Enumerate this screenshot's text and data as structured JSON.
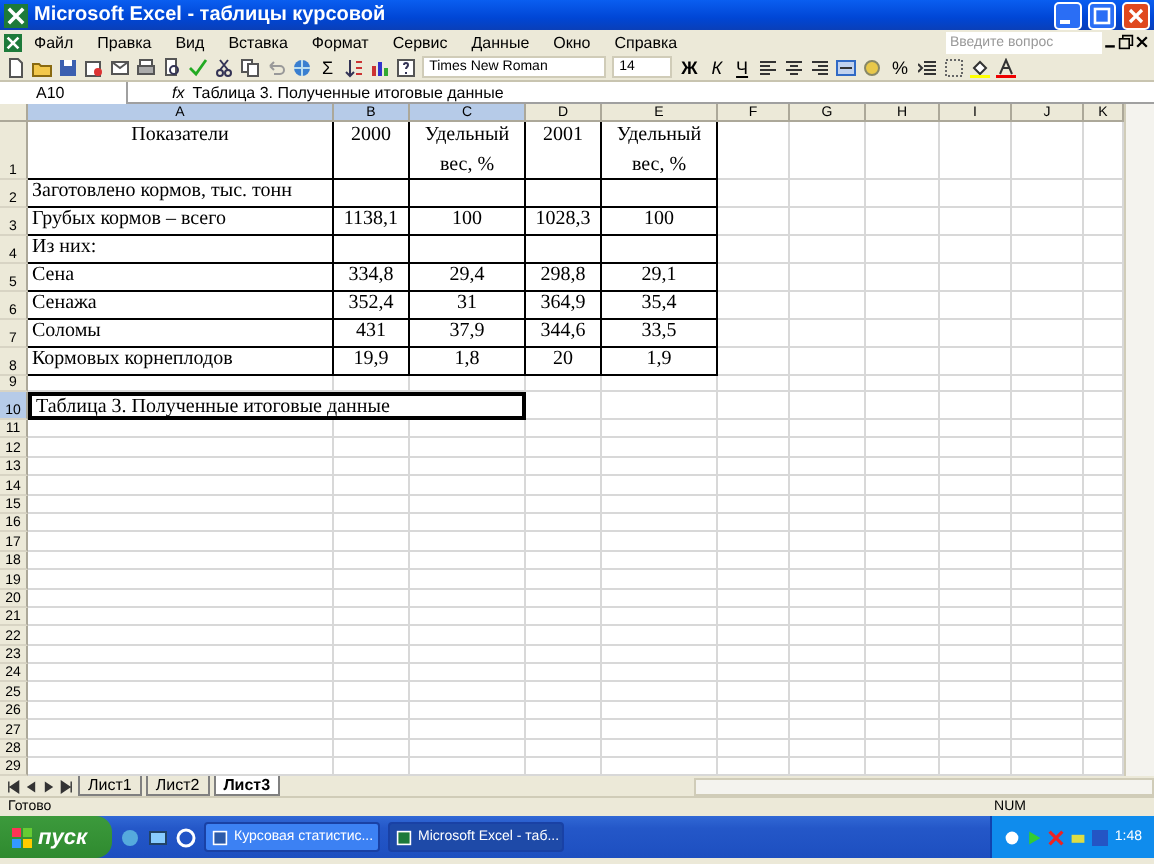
{
  "window": {
    "title": "Microsoft Excel - таблицы курсовой"
  },
  "menu": [
    "Файл",
    "Правка",
    "Вид",
    "Вставка",
    "Формат",
    "Сервис",
    "Данные",
    "Окно",
    "Справка"
  ],
  "help_field": {
    "placeholder": "Введите вопрос"
  },
  "toolbar": {
    "font": "Times New Roman",
    "size": "14",
    "bold": "Ж",
    "italic": "К",
    "underline": "Ч",
    "percent": "%",
    "sigma": "Σ"
  },
  "formula_bar": {
    "name_box": "A10",
    "fx": "fx",
    "value": "Таблица 3. Полученные итоговые данные"
  },
  "columns": [
    {
      "label": "A",
      "selected": true
    },
    {
      "label": "B",
      "selected": true
    },
    {
      "label": "C",
      "selected": true
    },
    {
      "label": "D",
      "selected": false
    },
    {
      "label": "E",
      "selected": false
    },
    {
      "label": "F",
      "selected": false
    },
    {
      "label": "G",
      "selected": false
    },
    {
      "label": "H",
      "selected": false
    },
    {
      "label": "I",
      "selected": false
    },
    {
      "label": "J",
      "selected": false
    },
    {
      "label": "K",
      "selected": false
    }
  ],
  "rows": [
    {
      "number": "1",
      "selected": false,
      "bordered": true,
      "cells": [
        "Показатели",
        "2000",
        "Удельный вес, %",
        "2001",
        "Удельный вес, %"
      ]
    },
    {
      "number": "2",
      "selected": false,
      "bordered": true,
      "cells": [
        "Заготовлено кормов, тыс. тонн"
      ]
    },
    {
      "number": "3",
      "selected": false,
      "bordered": true,
      "cells": [
        "Грубых кормов – всего",
        "1138,1",
        "100",
        "1028,3",
        "100"
      ]
    },
    {
      "number": "4",
      "selected": false,
      "bordered": true,
      "cells": [
        "Из них:"
      ]
    },
    {
      "number": "5",
      "selected": false,
      "bordered": true,
      "cells": [
        "Сена",
        "334,8",
        "29,4",
        "298,8",
        "29,1"
      ]
    },
    {
      "number": "6",
      "selected": false,
      "bordered": true,
      "cells": [
        "Сенажа",
        "352,4",
        "31",
        "364,9",
        "35,4"
      ]
    },
    {
      "number": "7",
      "selected": false,
      "bordered": true,
      "cells": [
        "Соломы",
        "431",
        "37,9",
        "344,6",
        "33,5"
      ]
    },
    {
      "number": "8",
      "selected": false,
      "bordered": true,
      "cells": [
        "Кормовых корнеплодов",
        "19,9",
        "1,8",
        "20",
        "1,9"
      ]
    },
    {
      "number": "9",
      "selected": false,
      "bordered": false
    },
    {
      "number": "10",
      "selected": true,
      "bordered": false,
      "merged": {
        "text": "Таблица 3. Полученные итоговые данные",
        "selected": true
      }
    },
    {
      "number": "11",
      "selected": false,
      "bordered": false
    },
    {
      "number": "12",
      "selected": false,
      "bordered": false
    },
    {
      "number": "13",
      "selected": false,
      "bordered": false
    },
    {
      "number": "14",
      "selected": false,
      "bordered": false
    },
    {
      "number": "15",
      "selected": false,
      "bordered": false
    },
    {
      "number": "16",
      "selected": false,
      "bordered": false
    },
    {
      "number": "17",
      "selected": false,
      "bordered": false
    },
    {
      "number": "18",
      "selected": false,
      "bordered": false
    },
    {
      "number": "19",
      "selected": false,
      "bordered": false
    },
    {
      "number": "20",
      "selected": false,
      "bordered": false
    },
    {
      "number": "21",
      "selected": false,
      "bordered": false
    },
    {
      "number": "22",
      "selected": false,
      "bordered": false
    },
    {
      "number": "23",
      "selected": false,
      "bordered": false
    },
    {
      "number": "24",
      "selected": false,
      "bordered": false
    },
    {
      "number": "25",
      "selected": false,
      "bordered": false
    },
    {
      "number": "26",
      "selected": false,
      "bordered": false
    },
    {
      "number": "27",
      "selected": false,
      "bordered": false
    },
    {
      "number": "28",
      "selected": false,
      "bordered": false
    },
    {
      "number": "29",
      "selected": false,
      "bordered": false
    }
  ],
  "sheet_tabs": [
    {
      "label": "Лист1",
      "selected": false
    },
    {
      "label": "Лист2",
      "selected": false
    },
    {
      "label": "Лист3",
      "selected": true
    }
  ],
  "status_bar": {
    "status": "Готово",
    "num": "NUM"
  },
  "taskbar": {
    "start": "пуск",
    "tasks": [
      {
        "label": "Курсовая статистис...",
        "selected": false
      },
      {
        "label": "Microsoft Excel - таб...",
        "selected": true
      }
    ],
    "clock": "1:48"
  }
}
